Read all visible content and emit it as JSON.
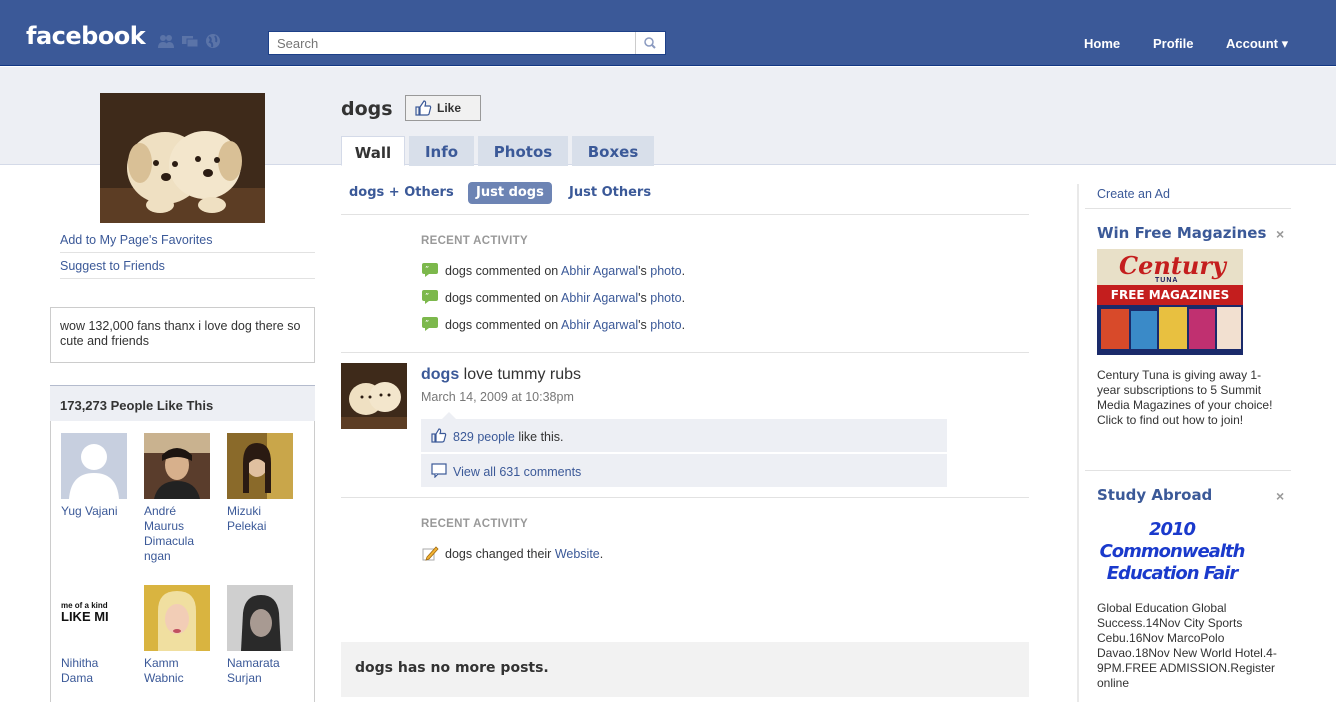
{
  "topbar": {
    "logo": "facebook",
    "search_placeholder": "Search",
    "nav": {
      "home": "Home",
      "profile": "Profile",
      "account": "Account ▾"
    }
  },
  "page": {
    "title": "dogs",
    "like_label": "Like",
    "tabs": [
      "Wall",
      "Info",
      "Photos",
      "Boxes"
    ],
    "filters": [
      "dogs + Others",
      "Just dogs",
      "Just Others"
    ]
  },
  "sidebar": {
    "links": [
      "Add to My Page's Favorites",
      "Suggest to Friends"
    ],
    "info_text": "wow 132,000 fans thanx i love dog there so cute and friends",
    "likes_header": "173,273 People Like This",
    "fans": [
      {
        "name": "Yug Vajani"
      },
      {
        "name": "André Maurus Dimacula ngan"
      },
      {
        "name": "Mizuki Pelekai"
      },
      {
        "name": "Nihitha Dama"
      },
      {
        "name": "Kamm Wabnic"
      },
      {
        "name": "Namarata Surjan"
      }
    ],
    "fan_image_text": {
      "line1": "me of a kind",
      "line2": "LIKE MI"
    }
  },
  "wall": {
    "recent_activity_label": "RECENT ACTIVITY",
    "activity_1": {
      "pre": "dogs commented on ",
      "person": "Abhir Agarwal",
      "mid": "'s ",
      "object": "photo",
      "post": "."
    },
    "post": {
      "author": "dogs",
      "text": " love tummy rubs",
      "time": "March 14, 2009 at 10:38pm",
      "likes_link": "829 people",
      "likes_suffix": " like this.",
      "comments_link": "View all 631 comments"
    },
    "activity_2": {
      "pre": "dogs changed their ",
      "object": "Website",
      "post": "."
    },
    "no_more": "dogs has no more posts."
  },
  "ads": {
    "create": "Create an Ad",
    "ad1": {
      "title": "Win Free Magazines",
      "image_brand": "Century",
      "image_sub": "TUNA",
      "image_banner": "FREE MAGAZINES",
      "text": "Century Tuna is giving away 1-year subscriptions to 5 Summit Media Magazines of your choice! Click to find out how to join!"
    },
    "ad2": {
      "title": "Study Abroad",
      "image_line1": "2010 Commonwealth",
      "image_line2": "Education Fair",
      "text": "Global Education Global Success.14Nov City Sports Cebu.16Nov MarcoPolo Davao.18Nov New World Hotel.4-9PM.FREE ADMISSION.Register online"
    },
    "close_glyph": "×"
  },
  "colors": {
    "brand": "#3b5998",
    "tab_bg": "#d8dfea",
    "band": "#edeff4"
  }
}
